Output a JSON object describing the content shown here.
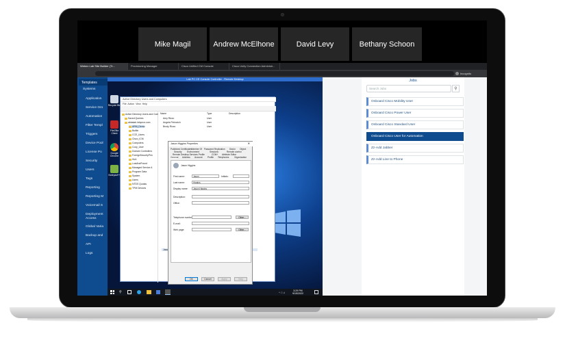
{
  "participants": [
    "Mike Magil",
    "Andrew McElhone",
    "David Levy",
    "Bethany Schoon"
  ],
  "browser": {
    "tabs": [
      "Webex Lab Site Builder (Tr...",
      "Provisioning Manager",
      "Cisco Unified CM Console",
      "Cisco Unity Connection Administr..."
    ],
    "profile": "Incognito"
  },
  "sidebar": {
    "title": "Templates",
    "items": [
      "Systems",
      "Application",
      "Service Gro",
      "Automation",
      "Filter Templ",
      "Triggers",
      "Device Pool",
      "License Po",
      "Security",
      "Users",
      "Tags",
      "Reporting",
      "Reporting M",
      "Voicemail S",
      "Deployment Access",
      "Global Varia",
      "Backup and",
      "API",
      "Logs"
    ]
  },
  "remote_desktop": {
    "title": "Lab PC CE Console Controller - Remote Desktop",
    "icons": [
      "Recycle Bin",
      "FileZilla Client",
      "Google Chrome",
      "Notepad++"
    ],
    "clock": {
      "time": "3:29 PM",
      "date": "9/15/2022"
    }
  },
  "aduc": {
    "title": "Active Directory Users and Computers",
    "menu": [
      "File",
      "Action",
      "View",
      "Help"
    ],
    "tree": [
      "Active Directory Users and Com",
      "Saved Queries",
      "abbalab.infoprox.com",
      "ARM_Demo",
      "Builtin",
      "CCE_Users",
      "Cisco_ICM",
      "Computers",
      "Cozy_User",
      "Domain Controllers",
      "ForeignSecurityPrin",
      "Hiz1",
      "LostAndFound",
      "Managed Service A",
      "Program Data",
      "System",
      "Users",
      "NTDS Quotas",
      "TPM Devices"
    ],
    "columns": [
      "Name",
      "Type",
      "Description"
    ],
    "rows": [
      {
        "name": "Amy Rizzo",
        "type": "User"
      },
      {
        "name": "Angela Petrovich",
        "type": "User"
      },
      {
        "name": "Brody Rizzo",
        "type": "User"
      },
      {
        "name": "Jason Higgins",
        "type": "User"
      }
    ]
  },
  "props": {
    "title": "Jason Higgins Properties",
    "tabs_row1": [
      "Published Certificates",
      "Member Of",
      "Password Replication",
      "Dial-in",
      "Object"
    ],
    "tabs_row2": [
      "Security",
      "Environment",
      "Sessions",
      "Remote control"
    ],
    "tabs_row3": [
      "Remote Desktop Services Profile",
      "COM+",
      "Attribute Editor"
    ],
    "tabs_row4": [
      "General",
      "Address",
      "Account",
      "Profile",
      "Telephones",
      "Organization"
    ],
    "user": "Jason Higgins",
    "fields": {
      "first_name_label": "First name:",
      "first_name": "Jason",
      "initials_label": "Initials:",
      "initials": "",
      "last_name_label": "Last name:",
      "last_name": "Higgins",
      "display_name_label": "Display name:",
      "display_name": "Jason Higgins",
      "description_label": "Description:",
      "description": "",
      "office_label": "Office:",
      "office": "",
      "telephone_label": "Telephone number:",
      "telephone": "",
      "email_label": "E-mail:",
      "email": "",
      "webpage_label": "Web page:",
      "webpage": ""
    },
    "other_label": "Other...",
    "buttons": [
      "OK",
      "Cancel",
      "Apply",
      "Help"
    ]
  },
  "jobs": {
    "title": "Jobs",
    "search_placeholder": "Search Jobs",
    "items": [
      "Onboard Cisco Mobility User",
      "Onboard Cisco Power User",
      "Onboard Cisco Standard User",
      "Onboard Cisco User for Automation",
      "Zz-Add Jabber",
      "Zz-Add Line to Phone"
    ],
    "selected_index": 3
  },
  "colors": {
    "accent": "#0f4c8f",
    "selected_job": "#0f4c8f",
    "taskbar": "#11161f"
  }
}
